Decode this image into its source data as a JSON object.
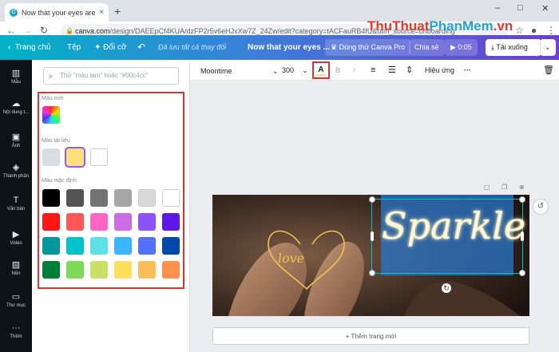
{
  "browser": {
    "tab_title": "Now that your eyes are open, m",
    "tab_close": "×",
    "new_tab": "+",
    "url_host": "canva.com",
    "url_path": "/design/DAEEpCf4KUA/dzFP2r5v6eHJxXw7Z_24Zw/edit?category=tACFauRB4fU&utm_source=onboarding",
    "window": {
      "minimize": "–",
      "maximize": "□",
      "close": "✕"
    }
  },
  "watermark": {
    "part1": "ThuThuat",
    "part2": "PhanMem",
    "part3": ".vn"
  },
  "topbar": {
    "home": "Trang chủ",
    "file": "Tệp",
    "resize": "Đổi cỡ",
    "saved": "Đã lưu tất cả thay đổi",
    "doc_title": "Now that your eyes ...",
    "try_pro": "Dùng thử Canva Pro",
    "share": "Chia sẻ",
    "play_time": "0:05",
    "download": "Tải xuống"
  },
  "toolbar": {
    "font": "Moontime",
    "size": "300",
    "text_color_letter": "A",
    "bold": "B",
    "italic": "I",
    "effects": "Hiệu ứng",
    "more": "···"
  },
  "sidebar": {
    "items": [
      {
        "label": "Mẫu",
        "icon": "▥"
      },
      {
        "label": "Nội dung t...",
        "icon": "☁"
      },
      {
        "label": "Ảnh",
        "icon": "▣"
      },
      {
        "label": "Thành phần",
        "icon": "◈"
      },
      {
        "label": "Văn bản",
        "icon": "T"
      },
      {
        "label": "Video",
        "icon": "▶"
      },
      {
        "label": "Nền",
        "icon": "▨"
      },
      {
        "label": "Thư mục",
        "icon": "▭"
      },
      {
        "label": "Thêm",
        "icon": "···"
      }
    ]
  },
  "color_panel": {
    "search_placeholder": "Thử \"màu lam\" hoặc \"#00c4cc\"",
    "new_color_label": "Màu mới",
    "doc_colors_label": "Màu tài liệu",
    "default_colors_label": "Màu mặc định",
    "doc_colors": [
      "#d7dde2",
      "#fde07a",
      "#ffffff"
    ],
    "default_colors": [
      [
        "#000000",
        "#545454",
        "#737373",
        "#a6a6a6",
        "#d9d9d9",
        "#ffffff"
      ],
      [
        "#ff1616",
        "#ff5757",
        "#ff66c4",
        "#cb6ce6",
        "#8c52ff",
        "#5e17eb"
      ],
      [
        "#03989e",
        "#00c2cb",
        "#5ce1e6",
        "#38b6ff",
        "#5271ff",
        "#004aad"
      ],
      [
        "#008037",
        "#7ed957",
        "#c9e265",
        "#ffde59",
        "#ffbd59",
        "#ff914d"
      ]
    ]
  },
  "canvas": {
    "sparkle_text": "Sparkle",
    "love_text": "love",
    "add_page": "+ Thêm trang mới"
  },
  "colors": {
    "accent_red": "#e0312d",
    "sidebar_bg": "#0e1318",
    "selection": "#00c4cc"
  }
}
